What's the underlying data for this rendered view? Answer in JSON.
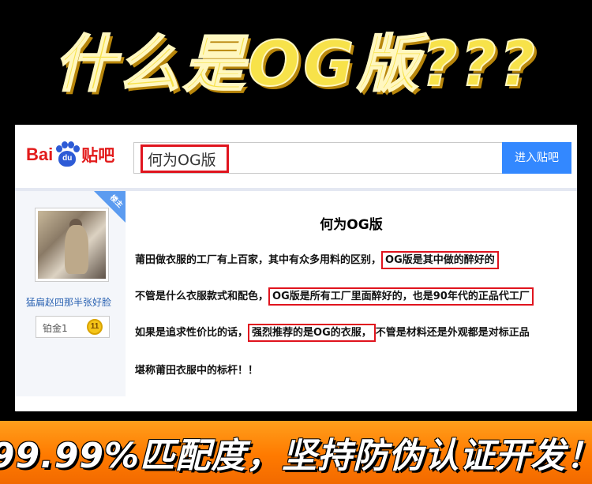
{
  "banner": {
    "title": "什么是OG版???",
    "subtitle": "99.99%匹配度，坚持防伪认证开发！"
  },
  "tieba": {
    "logo": {
      "bai": "Bai",
      "du": "du",
      "tieba": "贴吧"
    },
    "search": {
      "value": "何为OG版"
    },
    "enter_button": "进入贴吧"
  },
  "profile": {
    "badge": "楼主",
    "username": "猛扁赵四那半张好脸",
    "level_label": "铂金1",
    "level_number": "11"
  },
  "post": {
    "title": "何为OG版",
    "line1": {
      "text": "莆田做衣服的工厂有上百家，其中有众多用料的区别，",
      "highlight": "OG版是其中做的醉好的"
    },
    "line2": {
      "text": "不管是什么衣服款式和配色，",
      "highlight": "OG版是所有工厂里面醉好的，也是90年代的正品代工厂"
    },
    "line3": {
      "text": "如果是追求性价比的话，",
      "highlight": "强烈推荐的是OG的衣服，",
      "tail": "不管是材料还是外观都是对标正品"
    },
    "line4": {
      "text": "堪称莆田衣服中的标杆！！"
    }
  },
  "colors": {
    "accent_red": "#e0141e",
    "button_blue": "#3388ff",
    "banner_orange": "#ff7a00",
    "title_yellow": "#f7e24a"
  }
}
